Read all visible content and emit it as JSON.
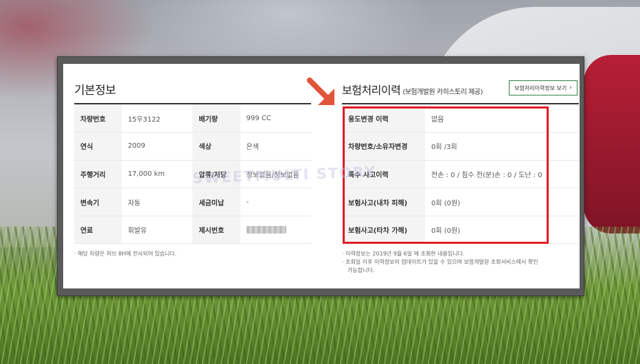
{
  "basic_info": {
    "title": "기본정보",
    "rows": [
      {
        "label1": "차량번호",
        "value1": "15우3122",
        "label2": "배기량",
        "value2": "999 CC"
      },
      {
        "label1": "연식",
        "value1": "2009",
        "label2": "색상",
        "value2": "은색"
      },
      {
        "label1": "주행거리",
        "value1": "17,000 km",
        "label2": "압류/저당",
        "value2": "정보없음/정보없음"
      },
      {
        "label1": "변속기",
        "value1": "자동",
        "label2": "세금미납",
        "value2": "-"
      },
      {
        "label1": "연료",
        "value1": "휘발유",
        "label2": "제시번호",
        "value2": ""
      }
    ],
    "note": "· 해당 차량은 허브 8H에 전시되어 있습니다."
  },
  "insurance": {
    "title": "보험처리이력",
    "subtitle": "(보험개발원 카히스토리 제공)",
    "history_button": "보험처리이력정보 보기",
    "rows": [
      {
        "label": "용도변경 이력",
        "value": "없음"
      },
      {
        "label": "차량번호/소유자변경",
        "value": "0회 /3회"
      },
      {
        "label": "특수 사고이력",
        "value": "전손 : 0 / 침수 전(분)손 : 0 / 도난 : 0"
      },
      {
        "label": "보험사고(내차 피해)",
        "value": "0회 (0원)"
      },
      {
        "label": "보험사고(타차 가해)",
        "value": "0회 (0원)"
      }
    ],
    "notes": [
      "· 이력정보는 2019년 9월 6일 에 조회한 내용입니다.",
      "· 조회일 이후 이력정보의 업데이트가 있을 수 있으며 보험개발원 조회서비스에서 확인",
      "가능합니다."
    ]
  },
  "watermark": "SWEETMULTI STORY",
  "colors": {
    "highlight": "#e01b24",
    "arrow": "#e0553a",
    "button_border": "#2f7a4b"
  },
  "icons": {
    "pointer_arrow": "down-right-arrow-icon",
    "button_chevron": "chevron-right-icon"
  }
}
